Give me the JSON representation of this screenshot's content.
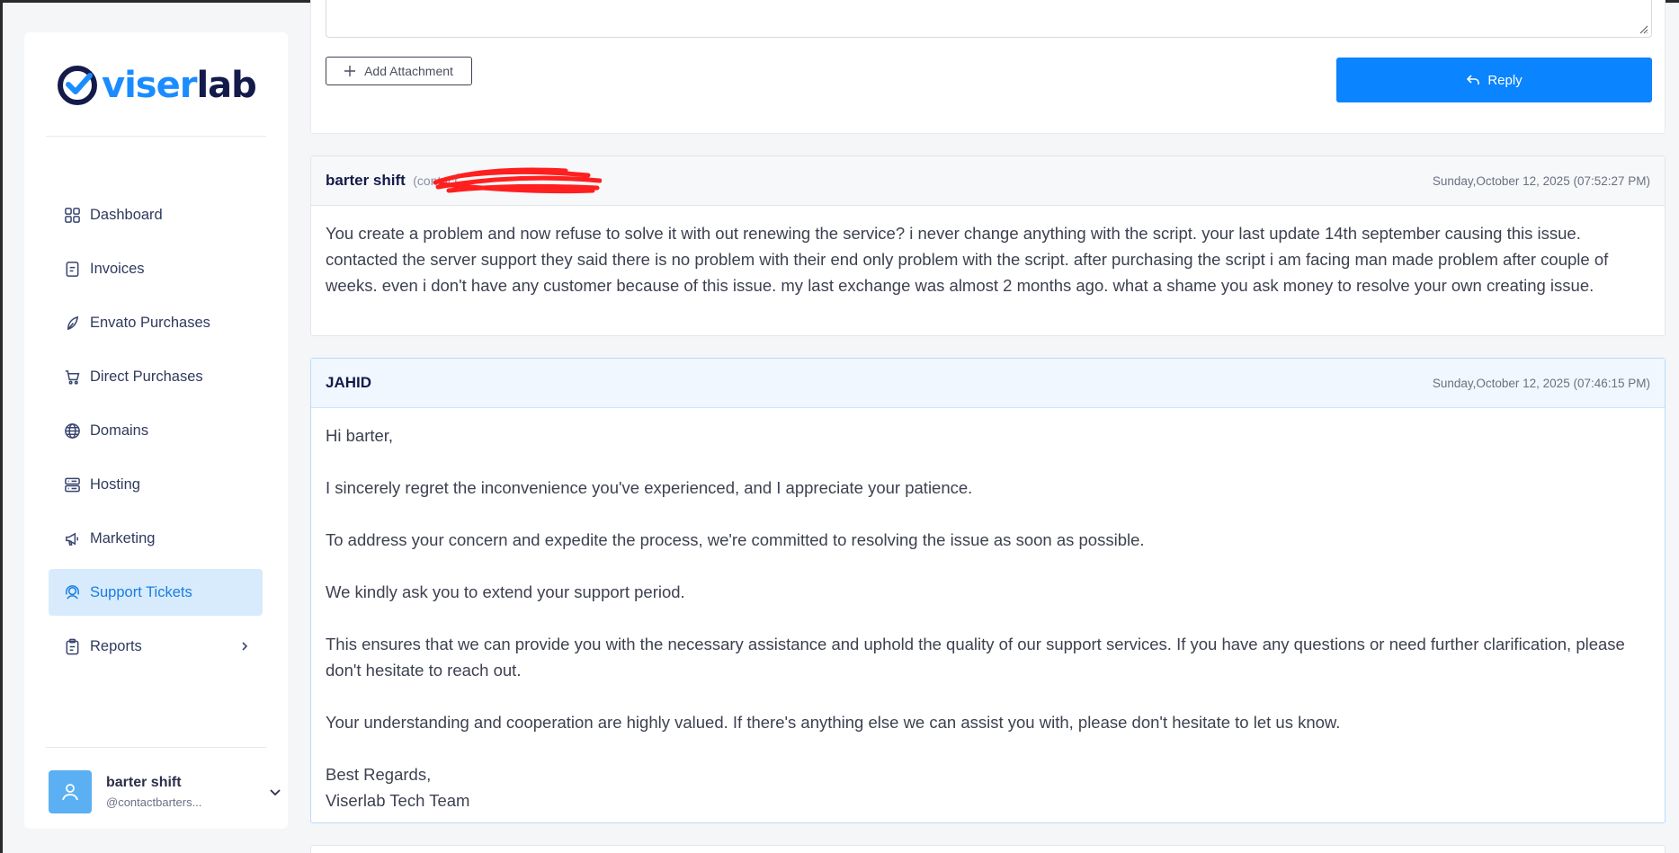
{
  "sidebar": {
    "logo": {
      "part1": "viser",
      "part2": "lab"
    },
    "items": [
      {
        "label": "Dashboard",
        "icon": "grid-icon",
        "active": false
      },
      {
        "label": "Invoices",
        "icon": "invoice-icon",
        "active": false
      },
      {
        "label": "Envato Purchases",
        "icon": "leaf-icon",
        "active": false
      },
      {
        "label": "Direct Purchases",
        "icon": "cart-icon",
        "active": false
      },
      {
        "label": "Domains",
        "icon": "globe-icon",
        "active": false
      },
      {
        "label": "Hosting",
        "icon": "server-icon",
        "active": false
      },
      {
        "label": "Marketing",
        "icon": "megaphone-icon",
        "active": false
      },
      {
        "label": "Support Tickets",
        "icon": "headset-icon",
        "active": true
      },
      {
        "label": "Reports",
        "icon": "clipboard-icon",
        "active": false,
        "has_submenu": true
      }
    ],
    "user": {
      "name": "barter shift",
      "handle": "@contactbarters..."
    }
  },
  "reply_form": {
    "attach_label": "Add Attachment",
    "reply_label": "Reply"
  },
  "messages": [
    {
      "author": "barter shift",
      "author_sub": "(contact",
      "time": "Sunday,October 12, 2025 (07:52:27 PM)",
      "body": "You create a problem and now refuse to solve it with out renewing the service? i never change anything with the script. your last update 14th september causing this issue. contacted the server support they said there is no problem with their end only problem with the script. after purchasing the script i am facing man made problem after couple of weeks. even i don't have any customer because of this issue. my last exchange was almost 2 months ago. what a shame you ask money to resolve your own creating issue."
    },
    {
      "author": "JAHID",
      "time": "Sunday,October 12, 2025 (07:46:15 PM)",
      "paragraphs": [
        "Hi barter,",
        "I sincerely regret the inconvenience you've experienced, and I appreciate your patience.",
        "To address your concern and expedite the process, we're committed to resolving the issue as soon as possible.",
        "We kindly ask you to extend your support period.",
        "This ensures that we can provide you with the necessary assistance and uphold the quality of our support services. If you have any questions or need further clarification, please don't hesitate to reach out.",
        "Your understanding and cooperation are highly valued. If there's anything else we can assist you with, please don't hesitate to let us know.",
        "Best Regards,\nViserlab Tech Team"
      ]
    }
  ],
  "colors": {
    "primary": "#0a84ff",
    "active_bg": "#d7ebfd",
    "brand_dark": "#141a4a",
    "avatar": "#5ab0f2",
    "redaction": "#ff1f1f"
  }
}
